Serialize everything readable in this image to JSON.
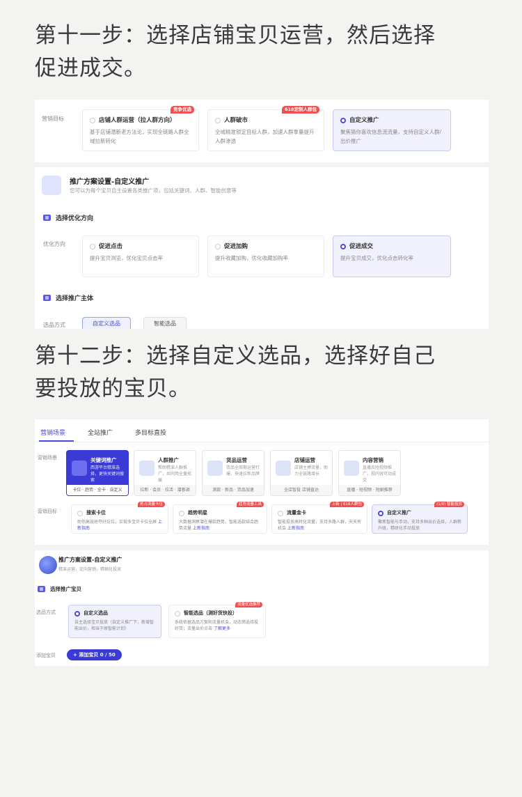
{
  "step11": "第十一步：选择店铺宝贝运营，然后选择\n促进成交。",
  "step12": "第十二步：选择自定义选品，选择好自己\n要投放的宝贝。",
  "panel1": {
    "goal_label": "营销目标",
    "cards": [
      {
        "title": "店铺人群运营（拉人群方向）",
        "desc": "基于店铺潜新老方法论，实现全链路人群全域拉新转化",
        "badge": "竞争优选"
      },
      {
        "title": "人群破市",
        "desc": "全域精准锁定目标人群，加速人群拿量提升人群渗透",
        "badge": "618定制人群包"
      },
      {
        "title": "自定义推广",
        "desc": "聚焦猜你喜欢信息流流量，支持自定义人群/出价推广",
        "badge": ""
      }
    ]
  },
  "panel2": {
    "plan_title": "推广方案设置-自定义推广",
    "plan_sub": "您可以为每个宝贝自主设置各类推广项，包括关键词、人群、智能创意等",
    "sec1": "选择优化方向",
    "opt_label": "优化方向",
    "cards": [
      {
        "title": "促进点击",
        "desc": "提升宝贝浏览，优化宝贝点击率"
      },
      {
        "title": "促进加购",
        "desc": "提升收藏加购，优化收藏加购率"
      },
      {
        "title": "促进成交",
        "desc": "提升宝贝成交，优化点击转化率"
      }
    ],
    "sec2": "选择推广主体",
    "select_label": "选品方式",
    "tab_custom": "自定义选品",
    "tab_smart": "智能选品"
  },
  "panel3": {
    "tabs": [
      "营销场景",
      "全站推广",
      "多目标直投"
    ],
    "scene_label": "营销场景",
    "scenes": [
      {
        "title": "关键词推广",
        "desc": "西游平台精准选择，更快关键词搜索",
        "foot": "卡位 · 趋势 · 全卡 · 自定义"
      },
      {
        "title": "人群推广",
        "desc": "帮助精准人群推广，共同用全量拓展",
        "foot": "拉新 · 会员 · 拉活 · 潜客调"
      },
      {
        "title": "货品运营",
        "desc": "货品全周期运营打爆，快速拉新品牌",
        "foot": "测款 · 新品 · 货品加速"
      },
      {
        "title": "店铺运营",
        "desc": "店铺主搏流量，助力全链路增长",
        "foot": "全店智投 店铺直达"
      },
      {
        "title": "内容营销",
        "desc": "直播及短视频推广，视内容可动成交",
        "foot": "直播 · 短视频 · 短剧推荐"
      }
    ],
    "goal_label": "营销目标",
    "goals": [
      {
        "title": "搜索卡位",
        "desc": "助你高效抢夺好坑位，实现多宝贝卡位全屏",
        "link": "上新指南",
        "badge": "抢占流量卡位"
      },
      {
        "title": "趋势明星",
        "desc": "大数据洞察潜在爆款趋势，智能选款结合趋势流量",
        "link": "上新指南",
        "badge": "趋势流量工具"
      },
      {
        "title": "流量金卡",
        "desc": "智能投放高转化流量，支持多路人群，天天有机会",
        "link": "上新指南",
        "badge": "上新 | 618人群包"
      },
      {
        "title": "自定义推广",
        "desc": "聚焦智能与手动，支持多种出价选择，人群新升级，精研化手动投放",
        "link": "",
        "badge": "(1/8) 智能投放"
      }
    ],
    "plan_title": "推广方案设置-自定义推广",
    "plan_sub": "精准运营，定向营销，精细化投放",
    "sec": "选择推广宝贝",
    "select_label": "选品方式",
    "sel_cards": [
      {
        "title": "自定义选品",
        "desc": "自主选择宝贝投放（自定义推广下，新增智能出价，相当于原智能计划）",
        "badge": ""
      },
      {
        "title": "智能选品（测好货快投）",
        "desc": "系统依据选品方案和流量机会，动态筛选待投好货；流量出价点击",
        "link": "了解更多",
        "badge": "流量优选推荐"
      }
    ],
    "add_label": "添加宝贝",
    "add_btn": "+ 添加宝贝 0 / 50"
  }
}
